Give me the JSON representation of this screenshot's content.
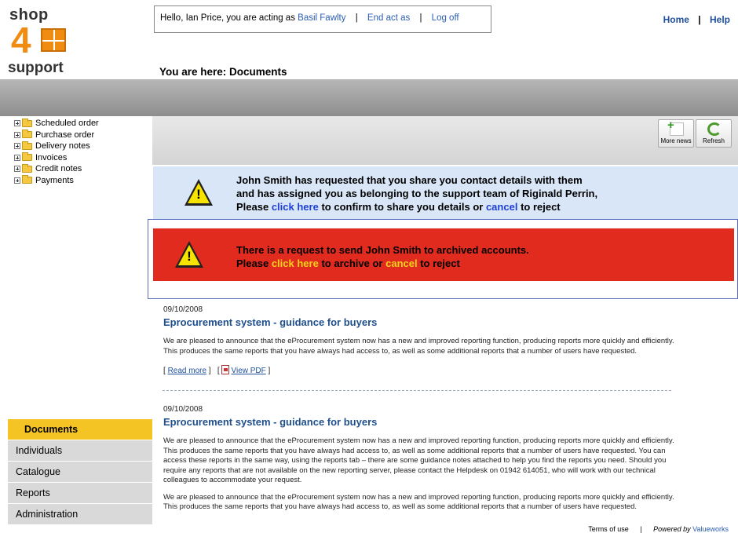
{
  "logo": {
    "line1": "shop",
    "digit": "4",
    "line2": "support"
  },
  "session": {
    "greeting": "Hello, Ian Price, you are acting as",
    "acting_as": "Basil Fawlty",
    "end_act": "End act as",
    "logoff": "Log off",
    "separator": "|"
  },
  "toplinks": {
    "home": "Home",
    "help": "Help",
    "separator": "|"
  },
  "breadcrumb": "You are here: Documents",
  "tree": [
    "Scheduled order",
    "Purchase order",
    "Delivery notes",
    "Invoices",
    "Credit notes",
    "Payments"
  ],
  "toolbar": {
    "more_news": "More news",
    "refresh": "Refresh"
  },
  "notice_share": {
    "line1": "John Smith has requested that you share you contact details with them",
    "line2": "and has assigned you as belonging to the support team of Riginald Perrin,",
    "line3_a": "Please",
    "line3_link": "click here",
    "line3_b": "to confirm to share you details or",
    "line3_cancel": "cancel",
    "line3_c": "to reject"
  },
  "notice_archive": {
    "line1": "There is a request to send John Smith to archived accounts.",
    "line2_a": "Please",
    "line2_link": "click here",
    "line2_b": "to archive or",
    "line2_cancel": "cancel",
    "line2_c": "to reject"
  },
  "articles": [
    {
      "date": "09/10/2008",
      "title": "Eprocurement system - guidance for buyers",
      "p1": "We are pleased to announce that the eProcurement system now has a new and improved reporting function, producing reports more quickly and efficiently. This produces the same reports that you have always had access to, as well as some additional reports that a number of users have requested.",
      "read_more": "Read more",
      "view_pdf": "View PDF"
    },
    {
      "date": "09/10/2008",
      "title": "Eprocurement system - guidance for buyers",
      "p1": "We are pleased to announce that the eProcurement system now has a new and improved reporting function, producing reports more quickly and efficiently. This produces the same reports that you have always had access to, as well as some additional reports that a number of users have requested. You can access these reports in the same way, using the reports tab – there are some guidance notes attached to help you find the reports you need. Should you require any reports that are not available on the new reporting server, please contact the Helpdesk on 01942 614051, who will work with our technical colleagues to accommodate your request.",
      "p2": "We are pleased to announce that the eProcurement system now has a new and improved reporting function, producing reports more quickly and efficiently. This produces the same reports that you have always had access to, as well as some additional reports that a number of users have requested."
    }
  ],
  "nav": [
    "Documents",
    "Individuals",
    "Catalogue",
    "Reports",
    "Administration"
  ],
  "footer": {
    "terms": "Terms of use",
    "separator": "|",
    "powered": "Powered by",
    "brand": "Valueworks"
  }
}
